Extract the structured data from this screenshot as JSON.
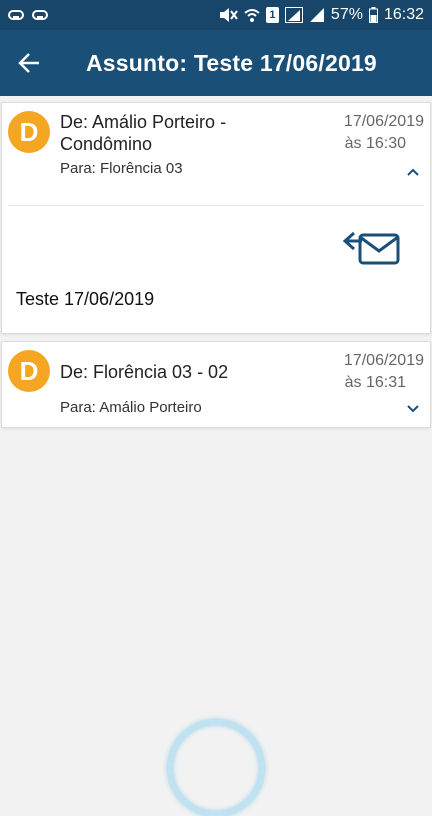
{
  "status_bar": {
    "battery": "57%",
    "time": "16:32",
    "sim_slot": "1"
  },
  "header": {
    "title": "Assunto: Teste 17/06/2019",
    "back_icon": "back-arrow-icon"
  },
  "messages": [
    {
      "avatar_letter": "D",
      "avatar_color": "#f5a623",
      "from": "De: Amálio Porteiro - Condômino",
      "to": "Para: Florência 03",
      "date": "17/06/2019",
      "time": "às 16:30",
      "expanded": true,
      "body": "Teste 17/06/2019",
      "action_icon": "reply-mail-icon"
    },
    {
      "avatar_letter": "D",
      "avatar_color": "#f5a623",
      "from": "De: Florência 03 - 02",
      "to": "Para: Amálio Porteiro",
      "date": "17/06/2019",
      "time": "às 16:31",
      "expanded": false
    }
  ],
  "colors": {
    "app_bar": "#1a4f78",
    "status_bar": "#17466a",
    "accent": "#1a4f78",
    "avatar": "#f5a623"
  }
}
